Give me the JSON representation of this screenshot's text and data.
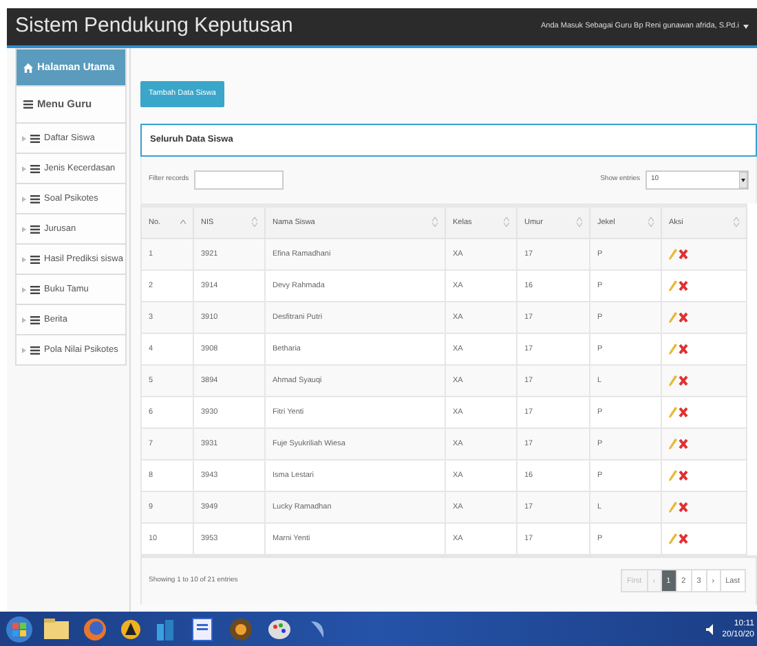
{
  "navbar": {
    "title": "Sistem Pendukung Keputusan",
    "user": "Anda Masuk Sebagai Guru Bp Reni gunawan afrida, S.Pd.i"
  },
  "sidebar": {
    "items": [
      {
        "label": "Halaman Utama",
        "kind": "home",
        "selected": true
      },
      {
        "label": "Menu Guru",
        "kind": "header",
        "selected": false
      },
      {
        "label": "Daftar Siswa",
        "kind": "item",
        "selected": false
      },
      {
        "label": "Jenis Kecerdasan",
        "kind": "item",
        "selected": false
      },
      {
        "label": "Soal Psikotes",
        "kind": "item",
        "selected": false
      },
      {
        "label": "Jurusan",
        "kind": "item",
        "selected": false
      },
      {
        "label": "Hasil Prediksi siswa",
        "kind": "item",
        "selected": false
      },
      {
        "label": "Buku Tamu",
        "kind": "item",
        "selected": false
      },
      {
        "label": "Berita",
        "kind": "item",
        "selected": false
      },
      {
        "label": "Pola Nilai Psikotes",
        "kind": "item",
        "selected": false
      }
    ]
  },
  "add_button": "Tambah Data Siswa",
  "panel": {
    "title": "Seluruh Data Siswa",
    "filter": {
      "label": "Filter records"
    },
    "show_entries": {
      "label": "Show entries",
      "value": "10"
    },
    "table": {
      "columns": [
        {
          "label": "No.",
          "sorted": true
        },
        {
          "label": "NIS",
          "sorted": false
        },
        {
          "label": "Nama Siswa",
          "sorted": false
        },
        {
          "label": "Kelas",
          "sorted": false
        },
        {
          "label": "Umur",
          "sorted": false
        },
        {
          "label": "Jekel",
          "sorted": false
        },
        {
          "label": "Aksi",
          "sorted": false
        }
      ],
      "rows": [
        [
          "1",
          "3921",
          "Efina Ramadhani",
          "XA",
          "17",
          "P"
        ],
        [
          "2",
          "3914",
          "Devy Rahmada",
          "XA",
          "16",
          "P"
        ],
        [
          "3",
          "3910",
          "Desfitrani Putri",
          "XA",
          "17",
          "P"
        ],
        [
          "4",
          "3908",
          "Betharia",
          "XA",
          "17",
          "P"
        ],
        [
          "5",
          "3894",
          "Ahmad Syauqi",
          "XA",
          "17",
          "L"
        ],
        [
          "6",
          "3930",
          "Fitri Yenti",
          "XA",
          "17",
          "P"
        ],
        [
          "7",
          "3931",
          "Fuje Syukriliah Wiesa",
          "XA",
          "17",
          "P"
        ],
        [
          "8",
          "3943",
          "Isma Lestari",
          "XA",
          "16",
          "P"
        ],
        [
          "9",
          "3949",
          "Lucky Ramadhan",
          "XA",
          "17",
          "L"
        ],
        [
          "10",
          "3953",
          "Marni Yenti",
          "XA",
          "17",
          "P"
        ]
      ]
    },
    "info": "Showing 1 to 10 of 21 entries",
    "pagination": [
      {
        "label": "First",
        "selected": false,
        "disabled": true
      },
      {
        "label": "‹",
        "selected": false,
        "disabled": true
      },
      {
        "label": "1",
        "selected": true,
        "disabled": false
      },
      {
        "label": "2",
        "selected": false,
        "disabled": false
      },
      {
        "label": "3",
        "selected": false,
        "disabled": false
      },
      {
        "label": "›",
        "selected": false,
        "disabled": false
      },
      {
        "label": "Last",
        "selected": false,
        "disabled": false
      }
    ]
  },
  "taskbar": {
    "time": "10:11",
    "date": "20/10/20"
  }
}
